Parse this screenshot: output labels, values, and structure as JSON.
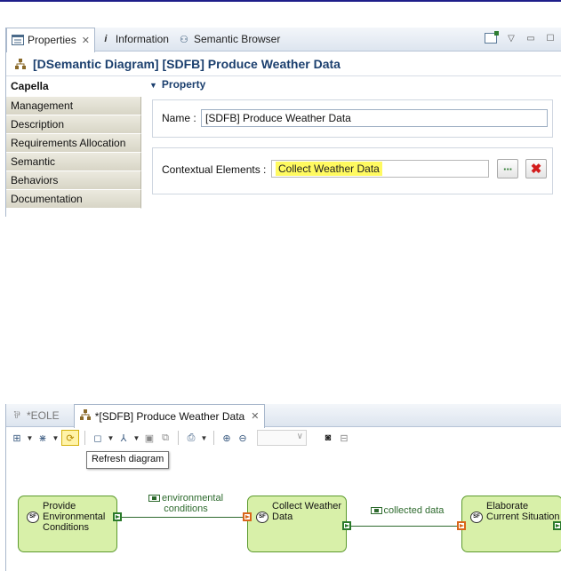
{
  "properties_view": {
    "tabs": [
      {
        "label": "Properties",
        "icon": "properties-icon",
        "closable": true
      },
      {
        "label": "Information",
        "icon": "information-icon"
      },
      {
        "label": "Semantic Browser",
        "icon": "semantic-browser-icon"
      }
    ],
    "title": "[DSemantic Diagram] [SDFB]  Produce Weather Data",
    "categories": [
      "Capella",
      "Management",
      "Description",
      "Requirements Allocation",
      "Semantic",
      "Behaviors",
      "Documentation"
    ],
    "active_category": "Capella",
    "section_title": "Property",
    "name_label": "Name :",
    "name_value": "[SDFB]  Produce Weather Data",
    "contextual_label": "Contextual Elements :",
    "contextual_value": "Collect Weather Data",
    "browse_button": "···",
    "delete_button": "✖",
    "highlight_color": "#fffa60"
  },
  "editor": {
    "tabs": [
      {
        "label": "*EOLE",
        "icon": "eole-diagram-icon",
        "active": false
      },
      {
        "label": "*[SDFB]  Produce Weather Data",
        "icon": "diagram-icon",
        "active": true,
        "closable": true
      }
    ],
    "toolbar": {
      "zoom_value": "",
      "tooltip": "Refresh diagram"
    },
    "functions": [
      {
        "name": "Provide\nEnvironmental\nConditions",
        "badge": "SF"
      },
      {
        "name": "Collect Weather\nData",
        "badge": "SF"
      },
      {
        "name": "Elaborate\nCurrent Situation",
        "badge": "SF"
      }
    ],
    "exchanges": [
      {
        "label": "environmental\nconditions"
      },
      {
        "label": "collected data"
      }
    ],
    "colors": {
      "function_fill": "#d8f0a9",
      "function_border": "#5c9a2e",
      "exchange": "#2d6a2d"
    }
  }
}
